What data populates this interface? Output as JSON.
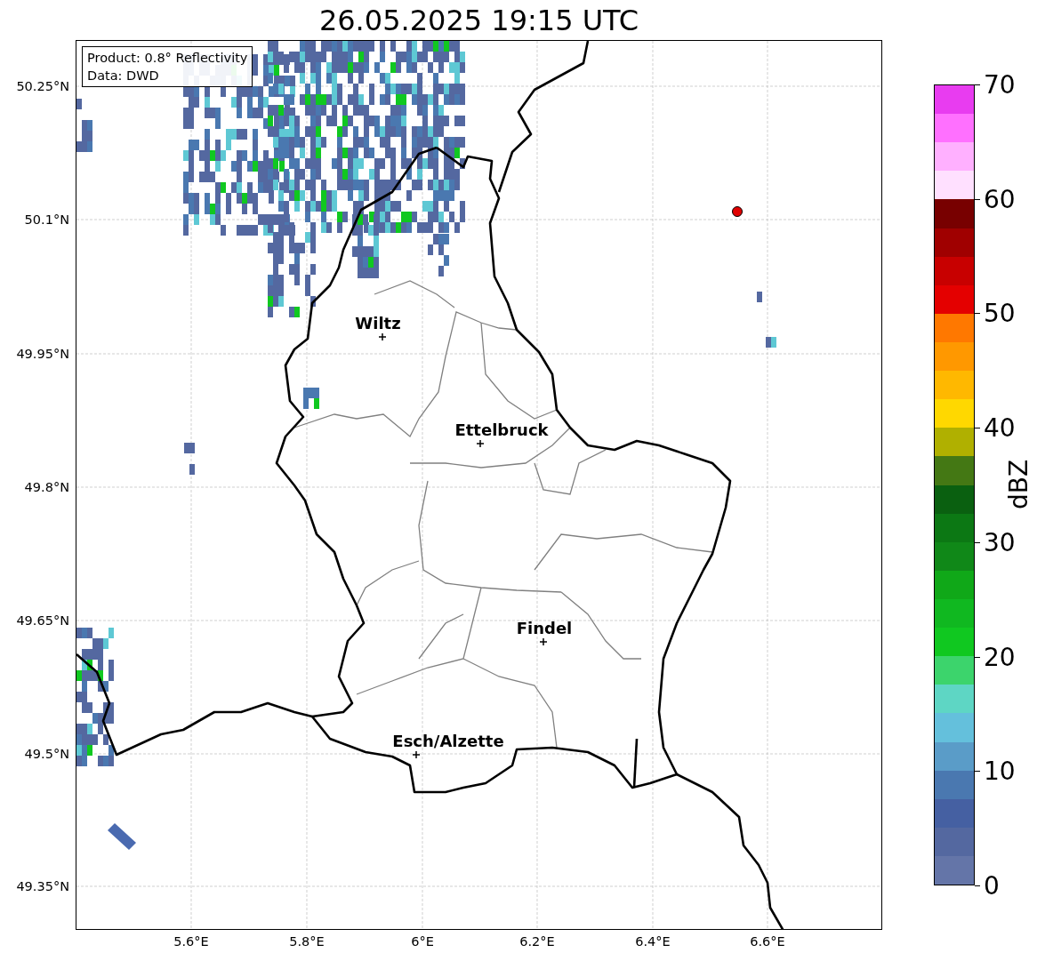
{
  "title": "26.05.2025 19:15 UTC",
  "info_box": [
    "Product: 0.8° Reflectivity",
    "Data: DWD"
  ],
  "lat_ticks": [
    "50.25°N",
    "50.1°N",
    "49.95°N",
    "49.8°N",
    "49.65°N",
    "49.5°N",
    "49.35°N"
  ],
  "lon_ticks": [
    "5.6°E",
    "5.8°E",
    "6°E",
    "6.2°E",
    "6.4°E",
    "6.6°E"
  ],
  "cities": [
    {
      "name": "Wiltz"
    },
    {
      "name": "Ettelbruck"
    },
    {
      "name": "Findel"
    },
    {
      "name": "Esch/Alzette"
    }
  ],
  "colorbar": {
    "label": "dBZ",
    "ticks": [
      "70",
      "60",
      "50",
      "40",
      "30",
      "20",
      "10",
      "0"
    ],
    "bins": [
      {
        "color": "#6475a8"
      },
      {
        "color": "#5468a0"
      },
      {
        "color": "#4560a2"
      },
      {
        "color": "#4a78b0"
      },
      {
        "color": "#5a9cc8"
      },
      {
        "color": "#64c0dc"
      },
      {
        "color": "#5ed6c4"
      },
      {
        "color": "#3cd46c"
      },
      {
        "color": "#10c820"
      },
      {
        "color": "#10b820"
      },
      {
        "color": "#10a818"
      },
      {
        "color": "#108818"
      },
      {
        "color": "#0c7814"
      },
      {
        "color": "#0a6010"
      },
      {
        "color": "#447814"
      },
      {
        "color": "#b0b000"
      },
      {
        "color": "#ffd800"
      },
      {
        "color": "#ffb800"
      },
      {
        "color": "#ff9800"
      },
      {
        "color": "#ff7800"
      },
      {
        "color": "#e40000"
      },
      {
        "color": "#c80000"
      },
      {
        "color": "#a00000"
      },
      {
        "color": "#780000"
      },
      {
        "color": "#ffe0ff"
      },
      {
        "color": "#ffb0ff"
      },
      {
        "color": "#ff70ff"
      },
      {
        "color": "#e83cf0"
      }
    ]
  }
}
